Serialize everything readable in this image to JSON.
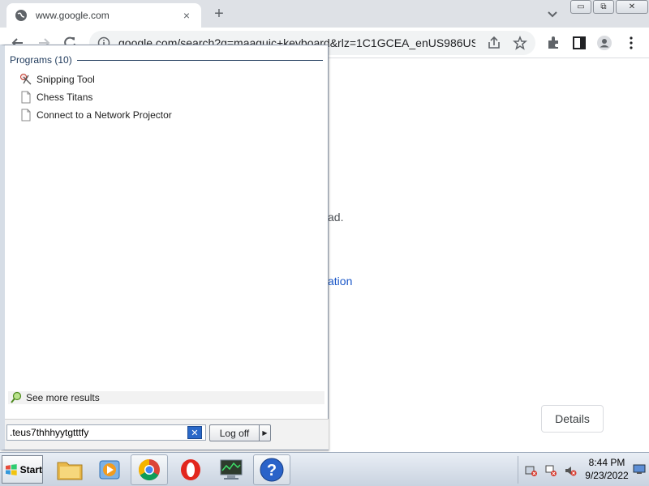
{
  "browser": {
    "tab_title": "www.google.com",
    "tab_close": "×",
    "new_tab": "+",
    "url": "google.com/search?q=maaguic+keyboard&rlz=1C1GCEA_enUS986US...",
    "window_buttons": {
      "minimize": "▭",
      "restore": "⧉",
      "close": "✕"
    }
  },
  "page": {
    "partial_text": "ad.",
    "partial_link": "ation",
    "details_button": "Details",
    "link_color": "#1a0dab"
  },
  "start_menu": {
    "programs_heading": "Programs (10)",
    "programs": [
      {
        "label": "Snipping Tool",
        "icon": "scissors-icon"
      },
      {
        "label": "Chess Titans",
        "icon": "document-icon"
      },
      {
        "label": "Connect to a Network Projector",
        "icon": "document-icon"
      }
    ],
    "see_more": "See more results",
    "search_value": ".teus7thhhyytgtttfy",
    "clear_label": "✕",
    "log_off": "Log off",
    "log_off_arrow": "▶"
  },
  "taskbar": {
    "start_label": "Start",
    "apps": [
      {
        "name": "file-explorer",
        "icon": "folder-icon"
      },
      {
        "name": "media-player",
        "icon": "media-player-icon"
      },
      {
        "name": "chrome",
        "icon": "chrome-icon"
      },
      {
        "name": "opera",
        "icon": "opera-icon"
      },
      {
        "name": "system-monitor",
        "icon": "monitor-icon"
      },
      {
        "name": "help",
        "icon": "help-icon"
      }
    ],
    "clock_time": "8:44 PM",
    "clock_date": "9/23/2022"
  }
}
